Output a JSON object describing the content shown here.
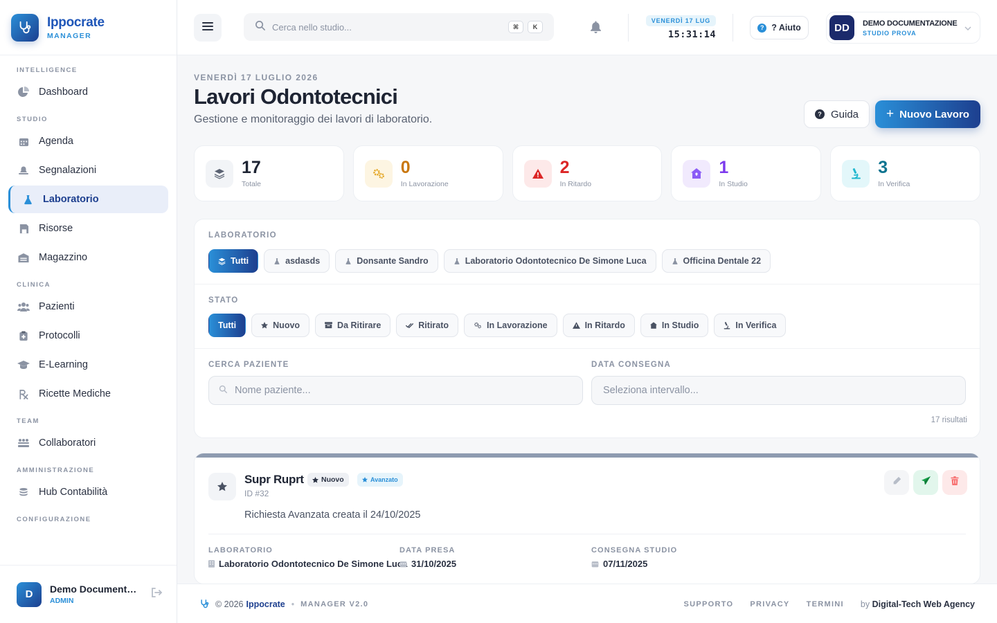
{
  "brand": {
    "name": "Ippocrate",
    "sub": "MANAGER"
  },
  "sidebar": {
    "sections": [
      {
        "title": "INTELLIGENCE",
        "items": [
          {
            "label": "Dashboard",
            "icon": "pie-chart-icon"
          }
        ]
      },
      {
        "title": "STUDIO",
        "items": [
          {
            "label": "Agenda",
            "icon": "calendar-icon"
          },
          {
            "label": "Segnalazioni",
            "icon": "bell-icon"
          },
          {
            "label": "Laboratorio",
            "icon": "flask-icon",
            "active": true
          },
          {
            "label": "Risorse",
            "icon": "save-icon"
          },
          {
            "label": "Magazzino",
            "icon": "warehouse-icon"
          }
        ]
      },
      {
        "title": "CLINICA",
        "items": [
          {
            "label": "Pazienti",
            "icon": "users-icon"
          },
          {
            "label": "Protocolli",
            "icon": "clipboard-icon"
          },
          {
            "label": "E-Learning",
            "icon": "graduation-cap-icon"
          },
          {
            "label": "Ricette Mediche",
            "icon": "prescription-icon"
          }
        ]
      },
      {
        "title": "TEAM",
        "items": [
          {
            "label": "Collaboratori",
            "icon": "team-icon"
          }
        ]
      },
      {
        "title": "AMMINISTRAZIONE",
        "items": [
          {
            "label": "Hub Contabilità",
            "icon": "coins-icon"
          }
        ]
      },
      {
        "title": "CONFIGURAZIONE",
        "items": []
      }
    ],
    "user": {
      "initial": "D",
      "name": "Demo Documenta…",
      "role": "ADMIN"
    }
  },
  "topbar": {
    "search_placeholder": "Cerca nello studio...",
    "kbd1": "⌘",
    "kbd2": "K",
    "clock_date": "VENERDÌ 17 LUG",
    "clock_time": "15:31:14",
    "help_label": "? Aiuto",
    "account": {
      "initials": "DD",
      "name": "DEMO DOCUMENTAZIONE",
      "sub": "STUDIO PROVA"
    }
  },
  "page": {
    "date": "VENERDÌ 17 LUGLIO 2026",
    "title": "Lavori Odontotecnici",
    "subtitle": "Gestione e monitoraggio dei lavori di laboratorio.",
    "guide_label": "Guida",
    "new_label": "Nuovo Lavoro"
  },
  "stats": [
    {
      "value": "17",
      "label": "Totale",
      "color": "#1e2433",
      "bg": "#f2f4f7",
      "icon": "layers-icon"
    },
    {
      "value": "0",
      "label": "In Lavorazione",
      "color": "#c9770f",
      "bg": "#fdf5e2",
      "icon": "gears-icon"
    },
    {
      "value": "2",
      "label": "In Ritardo",
      "color": "#dc2626",
      "bg": "#fde9e9",
      "icon": "warning-icon"
    },
    {
      "value": "1",
      "label": "In Studio",
      "color": "#7c3aed",
      "bg": "#f1eafd",
      "icon": "house-icon"
    },
    {
      "value": "3",
      "label": "In Verifica",
      "color": "#0e7490",
      "bg": "#e3f7fa",
      "icon": "microscope-icon"
    }
  ],
  "filters": {
    "lab_title": "LABORATORIO",
    "labs": [
      "Tutti",
      "asdasds",
      "Donsante Sandro",
      "Laboratorio Odontotecnico De Simone Luca",
      "Officina Dentale 22"
    ],
    "status_title": "STATO",
    "statuses": [
      "Tutti",
      "Nuovo",
      "Da Ritirare",
      "Ritirato",
      "In Lavorazione",
      "In Ritardo",
      "In Studio",
      "In Verifica"
    ],
    "search_label": "CERCA PAZIENTE",
    "search_placeholder": "Nome paziente...",
    "date_label": "DATA CONSEGNA",
    "date_placeholder": "Seleziona intervallo...",
    "results": "17 risultati"
  },
  "card": {
    "title": "Supr Ruprt",
    "badge1": "Nuovo",
    "badge2": "Avanzato",
    "id": "ID #32",
    "description": "Richiesta Avanzata creata il 24/10/2025",
    "meta": [
      {
        "label": "LABORATORIO",
        "value": "Laboratorio Odontotecnico De Simone Luca"
      },
      {
        "label": "DATA PRESA",
        "value": "31/10/2025"
      },
      {
        "label": "CONSEGNA STUDIO",
        "value": "07/11/2025"
      }
    ]
  },
  "footer": {
    "copyright": "© 2026",
    "brand": "Ippocrate",
    "version": "MANAGER V2.0",
    "links": [
      "SUPPORTO",
      "PRIVACY",
      "TERMINI"
    ],
    "by_prefix": "by",
    "by_name": "Digital-Tech Web Agency"
  }
}
